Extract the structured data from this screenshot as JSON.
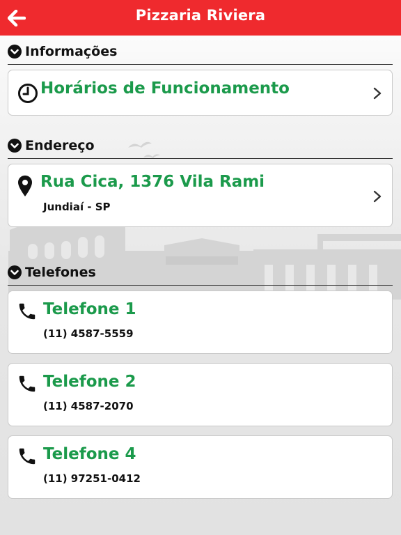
{
  "header": {
    "title": "Pizzaria Riviera",
    "back_icon": "arrow-left-icon"
  },
  "colors": {
    "header_bg": "#ef2a2e",
    "accent_green": "#1b9a4b"
  },
  "sections": {
    "info": {
      "label": "Informações",
      "items": [
        {
          "title": "Horários de Funcionamento",
          "icon": "clock-icon"
        }
      ]
    },
    "address": {
      "label": "Endereço",
      "items": [
        {
          "title": "Rua Cica, 1376 Vila Rami",
          "subtitle": "Jundiaí - SP",
          "icon": "map-pin-icon"
        }
      ]
    },
    "phones": {
      "label": "Telefones",
      "items": [
        {
          "title": "Telefone 1",
          "number": "(11) 4587-5559",
          "icon": "phone-icon"
        },
        {
          "title": "Telefone 2",
          "number": "(11) 4587-2070",
          "icon": "phone-icon"
        },
        {
          "title": "Telefone 4",
          "number": "(11) 97251-0412",
          "icon": "phone-icon"
        }
      ]
    }
  }
}
